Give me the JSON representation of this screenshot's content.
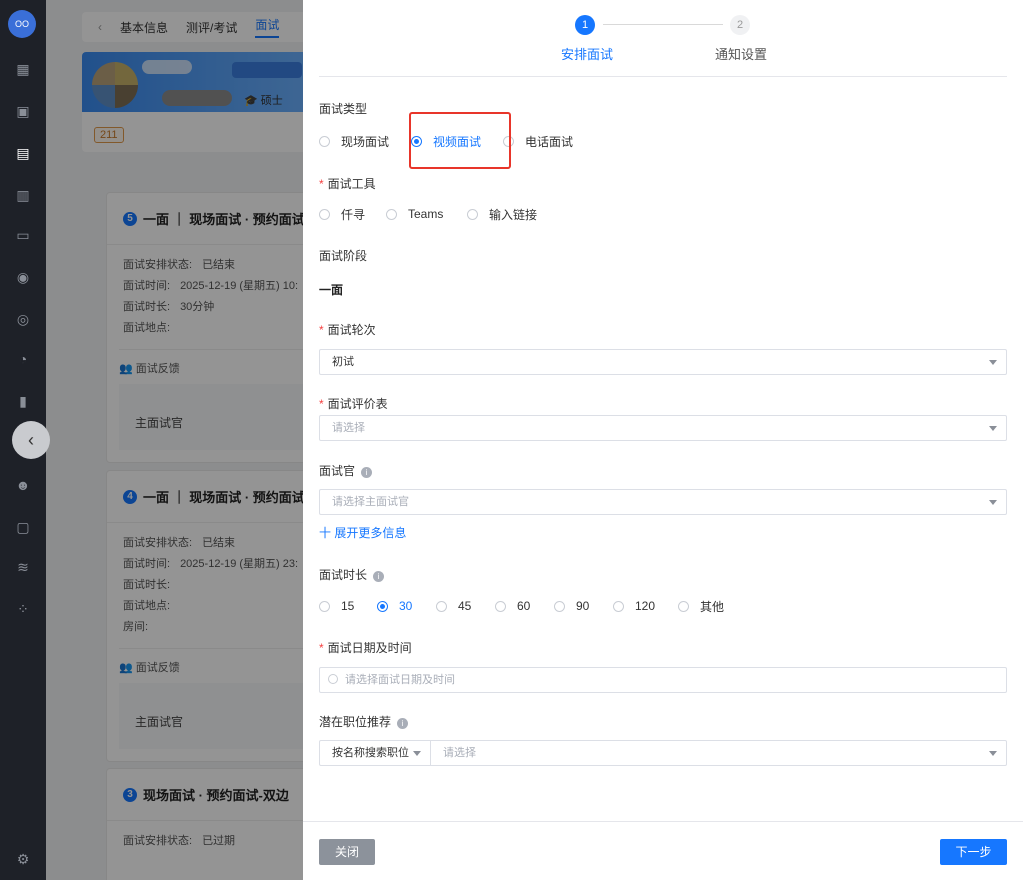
{
  "nav": {
    "logo_text": "OO"
  },
  "background": {
    "tabs": {
      "back": "‹",
      "basic": "基本信息",
      "eval": "测评/考试",
      "interview": "面试"
    },
    "profile": {
      "degree": "硕士",
      "tag": "211"
    },
    "cards": [
      {
        "num": "5",
        "title": "一面 ｜ 现场面试 · 预约面试",
        "rows": [
          [
            "面试安排状态:",
            "已结束"
          ],
          [
            "面试时间:",
            "2025-12-19 (星期五) 10:"
          ],
          [
            "面试时长:",
            "30分钟"
          ],
          [
            "面试地点:",
            ""
          ]
        ],
        "feedback": "面试反馈",
        "interviewer": "主面试官"
      },
      {
        "num": "4",
        "title": "一面 ｜ 现场面试 · 预约面试",
        "rows": [
          [
            "面试安排状态:",
            "已结束"
          ],
          [
            "面试时间:",
            "2025-12-19 (星期五) 23:"
          ],
          [
            "面试时长:",
            ""
          ],
          [
            "面试地点:",
            ""
          ],
          [
            "房间:",
            ""
          ]
        ],
        "feedback": "面试反馈",
        "interviewer": "主面试官"
      },
      {
        "num": "3",
        "title": "现场面试 · 预约面试-双边",
        "rows": [
          [
            "面试安排状态:",
            "已过期"
          ]
        ],
        "feedback": "",
        "interviewer": ""
      }
    ]
  },
  "drawer": {
    "steps": [
      {
        "num": "1",
        "label": "安排面试"
      },
      {
        "num": "2",
        "label": "通知设置"
      }
    ],
    "interview_type": {
      "label": "面试类型",
      "options": [
        "现场面试",
        "视频面试",
        "电话面试"
      ],
      "selected": "视频面试"
    },
    "tool": {
      "label": "面试工具",
      "options": [
        "仟寻",
        "Teams",
        "输入链接"
      ]
    },
    "stage": {
      "label": "面试阶段",
      "value": "一面"
    },
    "round": {
      "label": "面试轮次",
      "value": "初试"
    },
    "form_table": {
      "label": "面试评价表",
      "placeholder": "请选择"
    },
    "interviewer": {
      "label": "面试官",
      "placeholder": "请选择主面试官"
    },
    "expand": "十 展开更多信息",
    "duration": {
      "label": "面试时长",
      "options": [
        "15",
        "30",
        "45",
        "60",
        "90",
        "120",
        "其他"
      ],
      "selected": "30"
    },
    "datetime": {
      "label": "面试日期及时间",
      "placeholder": "请选择面试日期及时间"
    },
    "position": {
      "label": "潜在职位推荐",
      "mode": "按名称搜索职位",
      "placeholder": "请选择"
    },
    "footer": {
      "close": "关闭",
      "next": "下一步"
    }
  },
  "colors": {
    "primary": "#1677ff",
    "highlight_border": "#e8352a",
    "required": "#f53f3f"
  }
}
